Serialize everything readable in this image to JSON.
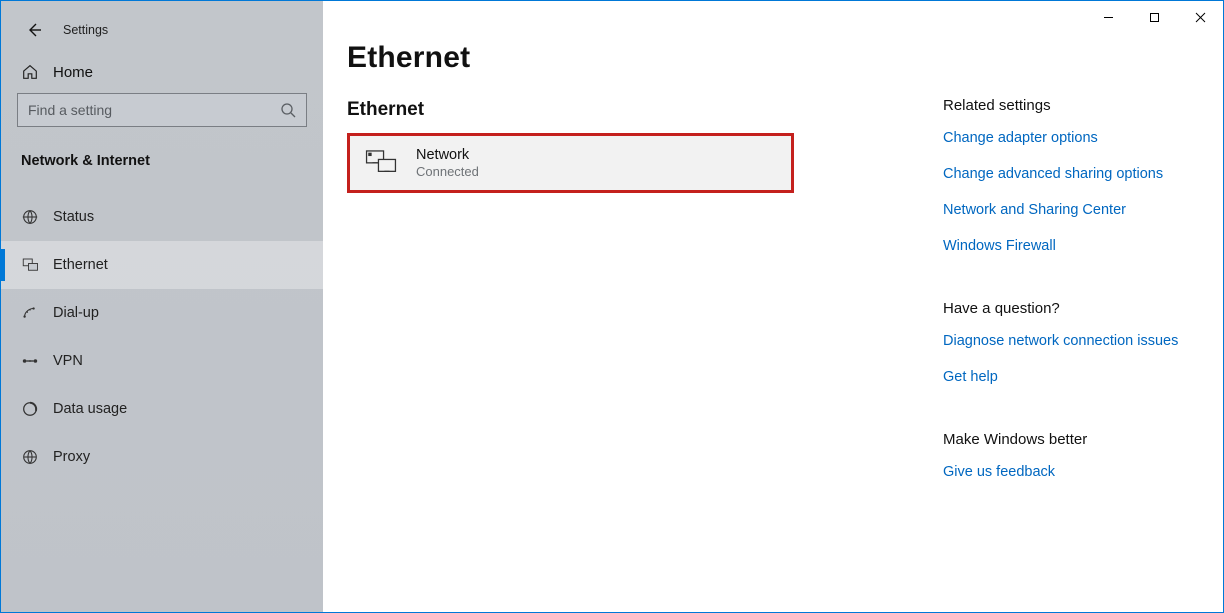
{
  "app_title": "Settings",
  "home_label": "Home",
  "search_placeholder": "Find a setting",
  "section_label": "Network & Internet",
  "nav": {
    "status": "Status",
    "ethernet": "Ethernet",
    "dialup": "Dial-up",
    "vpn": "VPN",
    "data_usage": "Data usage",
    "proxy": "Proxy"
  },
  "page": {
    "title": "Ethernet",
    "sub_heading": "Ethernet"
  },
  "network_card": {
    "name": "Network",
    "status": "Connected"
  },
  "related": {
    "heading": "Related settings",
    "links": [
      "Change adapter options",
      "Change advanced sharing options",
      "Network and Sharing Center",
      "Windows Firewall"
    ]
  },
  "question": {
    "heading": "Have a question?",
    "links": [
      "Diagnose network connection issues",
      "Get help"
    ]
  },
  "feedback": {
    "heading": "Make Windows better",
    "links": [
      "Give us feedback"
    ]
  }
}
